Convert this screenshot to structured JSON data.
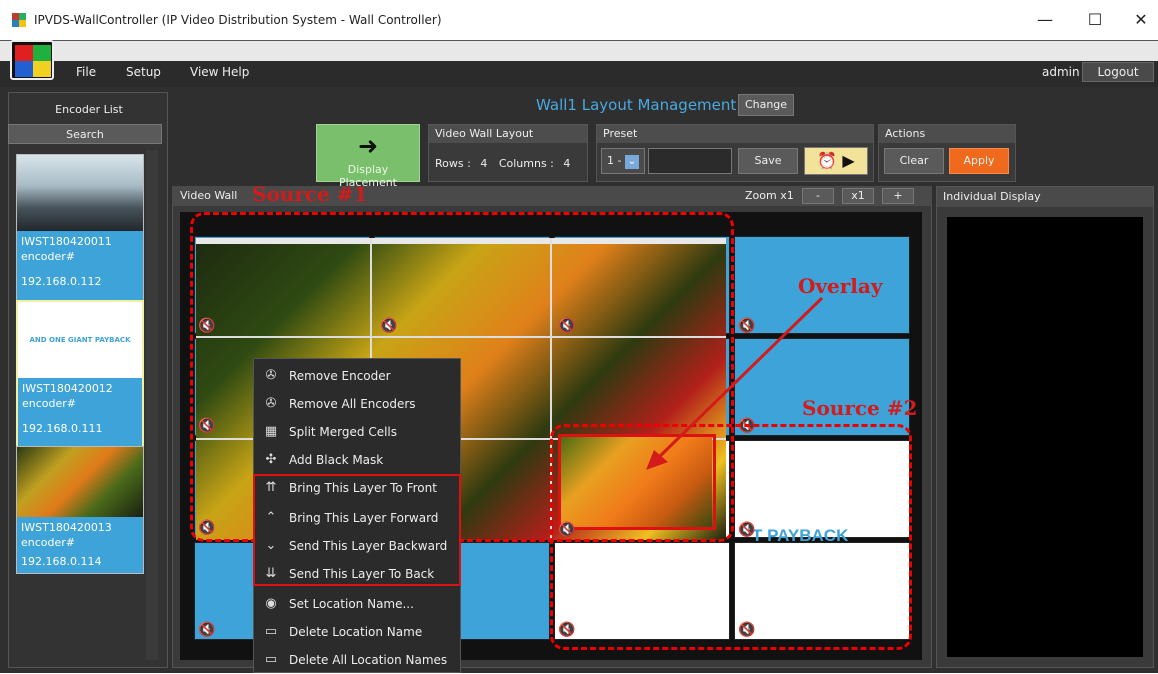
{
  "window": {
    "title": "IPVDS-WallController (IP Video Distribution System - Wall Controller)",
    "minimize": "—",
    "maximize": "☐",
    "close": "✕"
  },
  "menu": {
    "items": [
      "File",
      "Setup",
      "View",
      "Help"
    ],
    "user": "admin",
    "logout": "Logout"
  },
  "left": {
    "header": "Encoder List",
    "search": "Search",
    "encoders": [
      {
        "name": "IWST180420011",
        "type": "encoder#",
        "ip": "192.168.0.112",
        "thumb_text": ""
      },
      {
        "name": "IWST180420012",
        "type": "encoder#",
        "ip": "192.168.0.111",
        "thumb_text": "AND ONE GIANT PAYBACK"
      },
      {
        "name": "IWST180420013",
        "type": "encoder#",
        "ip": "192.168.0.114",
        "thumb_text": ""
      }
    ]
  },
  "center": {
    "title": "Wall1 Layout Management",
    "change": "Change",
    "display_placement": "Display Placement",
    "layout": {
      "header": "Video Wall Layout",
      "rows_label": "Rows :",
      "rows": "4",
      "cols_label": "Columns :",
      "cols": "4"
    },
    "preset": {
      "header": "Preset",
      "value": "1 -",
      "save": "Save"
    },
    "actions": {
      "header": "Actions",
      "clear": "Clear",
      "apply": "Apply"
    }
  },
  "videowall": {
    "label": "Video Wall",
    "zoom": "Zoom x1",
    "zoom_minus": "-",
    "zoom_x1": "x1",
    "zoom_plus": "+",
    "payback_text": "T PAYBACK"
  },
  "context_menu": {
    "items": [
      {
        "icon": "✇",
        "label": "Remove Encoder"
      },
      {
        "icon": "✇",
        "label": "Remove All Encoders"
      },
      {
        "icon": "▦",
        "label": "Split Merged Cells"
      },
      {
        "icon": "✣",
        "label": "Add Black Mask"
      },
      {
        "icon": "⇈",
        "label": "Bring This Layer To Front"
      },
      {
        "icon": "⌃",
        "label": "Bring This Layer Forward"
      },
      {
        "icon": "⌄",
        "label": "Send This Layer Backward"
      },
      {
        "icon": "⇊",
        "label": "Send This Layer To Back"
      },
      {
        "icon": "◉",
        "label": "Set Location Name..."
      },
      {
        "icon": "▭",
        "label": "Delete Location Name"
      },
      {
        "icon": "▭",
        "label": "Delete All Location Names"
      }
    ]
  },
  "annotations": {
    "source1": "Source #1",
    "source2": "Source #2",
    "overlay": "Overlay"
  },
  "individual": {
    "header": "Individual Display"
  },
  "colors": {
    "accent_blue": "#3ea3d8",
    "apply_orange": "#f06a1e",
    "annotation_red": "#d41a1a"
  }
}
